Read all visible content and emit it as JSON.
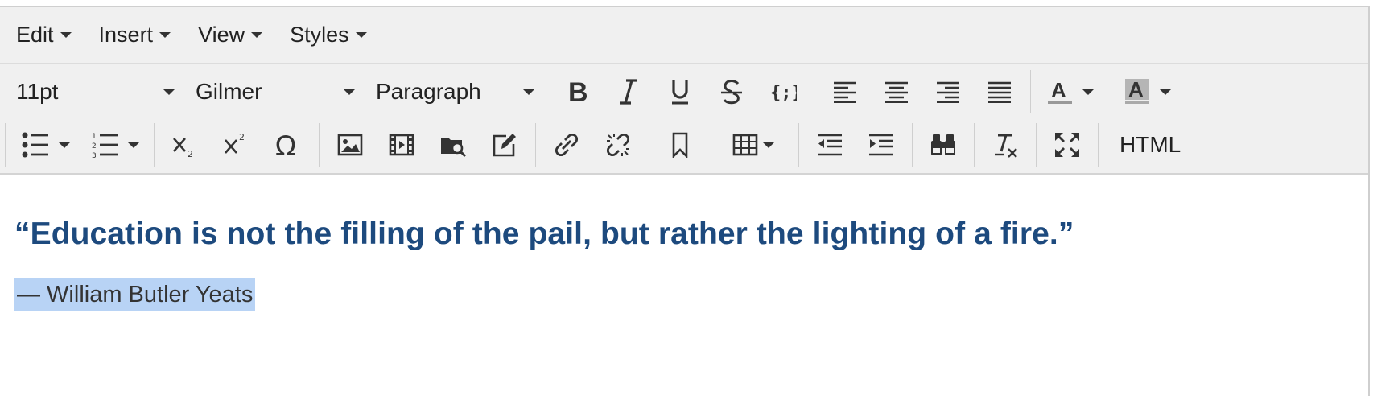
{
  "menubar": {
    "items": [
      "Edit",
      "Insert",
      "View",
      "Styles"
    ]
  },
  "toolbar": {
    "font_size": "11pt",
    "font_family": "Gilmer",
    "block_format": "Paragraph",
    "html_label": "HTML",
    "text_color": "#999999",
    "highlight_color": "#b0b0b0"
  },
  "content": {
    "quote": "“Education is not the filling of the pail, but rather the lighting of a fire.”",
    "author": "— William Butler Yeats",
    "quote_color": "#1d4a7e",
    "selection_color": "#b8d3f5"
  }
}
